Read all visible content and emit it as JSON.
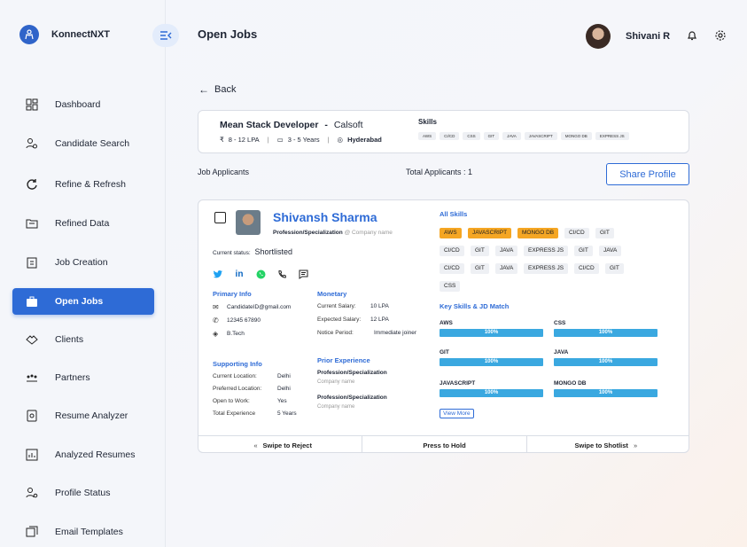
{
  "app": {
    "brand": "KonnectNXT"
  },
  "header": {
    "title": "Open Jobs",
    "user_name": "Shivani R"
  },
  "sidebar": {
    "items": [
      {
        "label": "Dashboard",
        "icon": "dashboard-icon",
        "active": false
      },
      {
        "label": "Candidate Search",
        "icon": "candidate-search-icon",
        "active": false
      },
      {
        "label": "Refine & Refresh",
        "icon": "refresh-icon",
        "active": false
      },
      {
        "label": "Refined Data",
        "icon": "folder-icon",
        "active": false
      },
      {
        "label": "Job Creation",
        "icon": "job-creation-icon",
        "active": false
      },
      {
        "label": "Open Jobs",
        "icon": "briefcase-icon",
        "active": true
      },
      {
        "label": "Clients",
        "icon": "handshake-icon",
        "active": false
      },
      {
        "label": "Partners",
        "icon": "partners-icon",
        "active": false
      },
      {
        "label": "Resume Analyzer",
        "icon": "resume-analyzer-icon",
        "active": false
      },
      {
        "label": "Analyzed Resumes",
        "icon": "bar-chart-icon",
        "active": false
      },
      {
        "label": "Profile Status",
        "icon": "profile-status-icon",
        "active": false
      },
      {
        "label": "Email Templates",
        "icon": "email-templates-icon",
        "active": false
      }
    ]
  },
  "back_label": "Back",
  "job": {
    "title": "Mean Stack Developer",
    "dash": "-",
    "company": "Calsoft",
    "salary": "8 - 12 LPA",
    "experience": "3 - 5 Years",
    "location": "Hyderabad",
    "skills_label": "Skills",
    "skills": [
      "AWS",
      "CI/CD",
      "CSS",
      "GIT",
      "JAVA",
      "JAVASCRIPT",
      "MONGO DB",
      "EXPRESS JS"
    ]
  },
  "applicants": {
    "label": "Job Applicants",
    "total": "Total Applicants : 1",
    "share_button": "Share Profile"
  },
  "candidate": {
    "name": "Shivansh Sharma",
    "profession": "Profession/Specialization",
    "company_placeholder": "@ Company name",
    "status_label": "Current status:",
    "status": "Shortlisted",
    "primary_info_label": "Primary Info",
    "email": "CandidateID@gmail.com",
    "phone": "12345 67890",
    "education": "B.Tech",
    "monetary_label": "Monetary",
    "current_salary_label": "Current Salary:",
    "current_salary": "10 LPA",
    "expected_salary_label": "Expected Salary:",
    "expected_salary": "12 LPA",
    "notice_label": "Notice Period:",
    "notice": "Immediate joiner",
    "supporting_info_label": "Supporting Info",
    "current_location_label": "Current Location:",
    "current_location": "Delhi",
    "preferred_location_label": "Preferred Location:",
    "preferred_location": "Delhi",
    "open_to_work_label": "Open to Work:",
    "open_to_work": "Yes",
    "total_experience_label": "Total Experience",
    "total_experience": "5 Years",
    "prior_experience_label": "Prior Experience",
    "prior": [
      {
        "role": "Profession/Specialization",
        "company": "Company name"
      },
      {
        "role": "Profession/Specialization",
        "company": "Company name"
      }
    ],
    "all_skills_label": "All Skills",
    "all_skills_rows": [
      [
        "AWS",
        "JAVASCRIPT",
        "MONGO DB",
        "CI/CD",
        "GIT"
      ],
      [
        "CI/CD",
        "GIT",
        "JAVA",
        "EXPRESS JS",
        "GIT",
        "JAVA"
      ],
      [
        "CI/CD",
        "GIT",
        "JAVA",
        "EXPRESS JS",
        "CI/CD",
        "GIT"
      ],
      [
        "CSS"
      ]
    ],
    "highlight_skills": [
      "AWS",
      "JAVASCRIPT",
      "MONGO DB"
    ],
    "match_label": "Key Skills & JD Match",
    "matches": [
      {
        "skill": "AWS",
        "percent": 100,
        "text": "100%"
      },
      {
        "skill": "CSS",
        "percent": 100,
        "text": "100%"
      },
      {
        "skill": "GIT",
        "percent": 100,
        "text": "100%"
      },
      {
        "skill": "JAVA",
        "percent": 100,
        "text": "100%"
      },
      {
        "skill": "JAVASCRIPT",
        "percent": 100,
        "text": "100%"
      },
      {
        "skill": "MONGO DB",
        "percent": 100,
        "text": "100%"
      }
    ],
    "view_more": "View More"
  },
  "actions": {
    "reject": "Swipe to Reject",
    "hold": "Press to Hold",
    "shortlist": "Swipe to Shotlist",
    "left_arrows": "«",
    "right_arrows": "»"
  },
  "colors": {
    "accent": "#2e6bd6",
    "highlight": "#f5a623",
    "bar": "#3aa8e0"
  }
}
